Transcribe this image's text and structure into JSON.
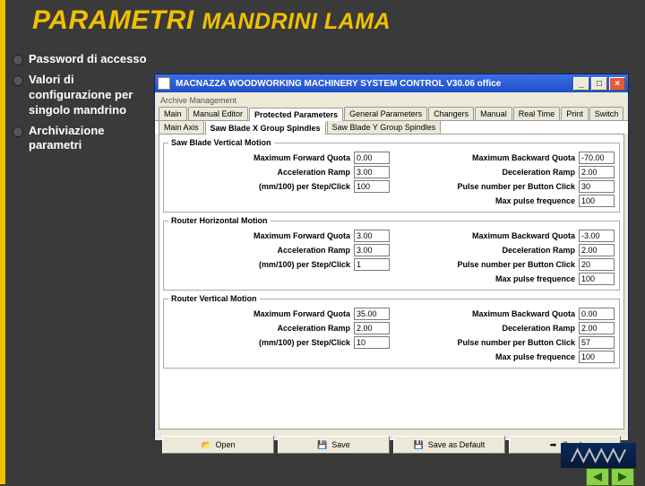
{
  "slide": {
    "title_main": "PARAMETRI",
    "title_sub": "MANDRINI LAMA",
    "bullets": [
      "Password di accesso",
      "Valori di configurazione per singolo mandrino",
      "Archiviazione parametri"
    ]
  },
  "window": {
    "title": "MACNAZZA WOODWORKING MACHINERY SYSTEM CONTROL  V30.06 office",
    "subtitle": "Archive Management",
    "tabs_top": [
      "Main",
      "Manual Editor",
      "Protected Parameters",
      "General Parameters",
      "Changers",
      "Manual",
      "Real Time",
      "Print",
      "Switch"
    ],
    "tabs_top_active": 2,
    "tabs_sub": [
      "Main Axis",
      "Saw Blade X Group Spindles",
      "Saw Blade Y Group Spindles"
    ],
    "tabs_sub_active": 1
  },
  "groups": [
    {
      "legend": "Saw Blade Vertical Motion",
      "rows": [
        [
          {
            "label": "Maximum Forward Quota",
            "value": "0.00"
          },
          {
            "label": "Maximum Backward Quota",
            "value": "-70.00"
          }
        ],
        [
          {
            "label": "Acceleration Ramp",
            "value": "3.00"
          },
          {
            "label": "Deceleration Ramp",
            "value": "2.00"
          }
        ],
        [
          {
            "label": "(mm/100) per Step/Click",
            "value": "100"
          },
          {
            "label": "Pulse number per Button Click",
            "value": "30"
          }
        ],
        [
          {
            "label": "",
            "value": ""
          },
          {
            "label": "Max pulse frequence",
            "value": "100"
          }
        ]
      ]
    },
    {
      "legend": "Router Horizontal Motion",
      "rows": [
        [
          {
            "label": "Maximum Forward Quota",
            "value": "3.00"
          },
          {
            "label": "Maximum Backward Quota",
            "value": "-3.00"
          }
        ],
        [
          {
            "label": "Acceleration Ramp",
            "value": "3.00"
          },
          {
            "label": "Deceleration Ramp",
            "value": "2.00"
          }
        ],
        [
          {
            "label": "(mm/100) per Step/Click",
            "value": "1"
          },
          {
            "label": "Pulse number per Button Click",
            "value": "20"
          }
        ],
        [
          {
            "label": "",
            "value": ""
          },
          {
            "label": "Max pulse frequence",
            "value": "100"
          }
        ]
      ]
    },
    {
      "legend": "Router Vertical Motion",
      "rows": [
        [
          {
            "label": "Maximum Forward Quota",
            "value": "35.00"
          },
          {
            "label": "Maximum Backward Quota",
            "value": "0.00"
          }
        ],
        [
          {
            "label": "Acceleration Ramp",
            "value": "2.00"
          },
          {
            "label": "Deceleration Ramp",
            "value": "2.00"
          }
        ],
        [
          {
            "label": "(mm/100) per Step/Click",
            "value": "10"
          },
          {
            "label": "Pulse number per Button Click",
            "value": "57"
          }
        ],
        [
          {
            "label": "",
            "value": ""
          },
          {
            "label": "Max pulse frequence",
            "value": "100"
          }
        ]
      ]
    }
  ],
  "buttons": {
    "open": "Open",
    "save": "Save",
    "save_default": "Save as Default",
    "send": "Send"
  }
}
